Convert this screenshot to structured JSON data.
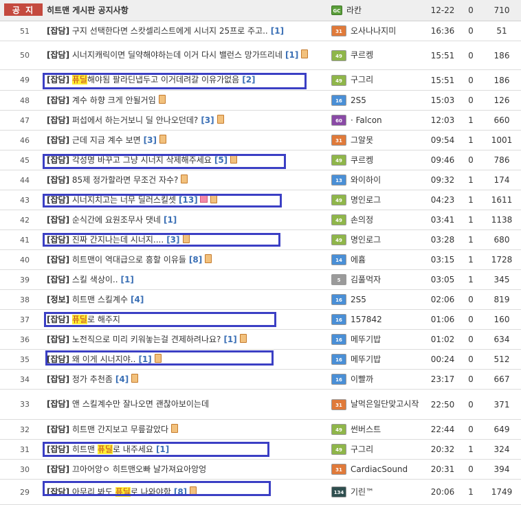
{
  "notice": {
    "badge": "공 지",
    "title": "히트맨 게시판 공지사항",
    "author": "라칸",
    "author_badge": "GC",
    "date": "12-22",
    "recommend": "0",
    "views": "710"
  },
  "rows": [
    {
      "num": "51",
      "cat": "[잡담]",
      "parts": [
        {
          "t": "구지 선택한다면 스캇셀리스트에게 시너지 25프로 주고..",
          "hl": false
        }
      ],
      "comments": "[1]",
      "note": false,
      "img": false,
      "author": "오사나나지미",
      "level": "31",
      "level_color": "#e07a3a",
      "time": "16:36",
      "rec": "0",
      "views": "51"
    },
    {
      "num": "50",
      "cat": "[잡담]",
      "parts": [
        {
          "t": "시너지캐릭이면 딜약해야하는데 이거 다시 밸런스 망가뜨리네",
          "hl": false
        }
      ],
      "comments": "[1]",
      "note": true,
      "img": false,
      "author": "쿠르켕",
      "level": "49",
      "level_color": "#8fb64a",
      "time": "15:51",
      "rec": "0",
      "views": "186"
    },
    {
      "num": "49",
      "cat": "[잡담]",
      "parts": [
        {
          "t": "퓨딜",
          "hl": true
        },
        {
          "t": "해야됨 팔라딘냅두고 이거데려갈 이유가없음",
          "hl": false
        }
      ],
      "comments": "[2]",
      "note": false,
      "img": false,
      "author": "구그리",
      "level": "49",
      "level_color": "#8fb64a",
      "time": "15:51",
      "rec": "0",
      "views": "186"
    },
    {
      "num": "48",
      "cat": "[잡담]",
      "parts": [
        {
          "t": "계수 하향 크게 안될거임",
          "hl": false
        }
      ],
      "comments": "",
      "note": true,
      "img": false,
      "author": "2S5",
      "level": "16",
      "level_color": "#4a8fd6",
      "time": "15:03",
      "rec": "0",
      "views": "126"
    },
    {
      "num": "47",
      "cat": "[잡담]",
      "parts": [
        {
          "t": "퍼섭에서 하는거보니 딜 안나오던데?",
          "hl": false
        }
      ],
      "comments": "[3]",
      "note": true,
      "img": false,
      "author": "· Falcon",
      "level": "60",
      "level_color": "#8a4aa6",
      "time": "12:03",
      "rec": "1",
      "views": "660"
    },
    {
      "num": "46",
      "cat": "[잡담]",
      "parts": [
        {
          "t": "근데 지금 계수 보면",
          "hl": false
        }
      ],
      "comments": "[3]",
      "note": true,
      "img": false,
      "author": "그알못",
      "level": "31",
      "level_color": "#e07a3a",
      "time": "09:54",
      "rec": "1",
      "views": "1001"
    },
    {
      "num": "45",
      "cat": "[잡담]",
      "parts": [
        {
          "t": "각성명 바꾸고 그냥 시너지 삭제해주세요",
          "hl": false
        }
      ],
      "comments": "[5]",
      "note": true,
      "img": false,
      "author": "쿠르켕",
      "level": "49",
      "level_color": "#8fb64a",
      "time": "09:46",
      "rec": "0",
      "views": "786"
    },
    {
      "num": "44",
      "cat": "[잡담]",
      "parts": [
        {
          "t": "85제 정가할라면 무조건 자수?",
          "hl": false
        }
      ],
      "comments": "",
      "note": true,
      "img": false,
      "author": "와이하이",
      "level": "13",
      "level_color": "#4a8fd6",
      "time": "09:32",
      "rec": "1",
      "views": "174"
    },
    {
      "num": "43",
      "cat": "[잡담]",
      "parts": [
        {
          "t": "시너지치고는 너무 딜러스킬셋",
          "hl": false
        }
      ],
      "comments": "[13]",
      "note": true,
      "img": true,
      "author": "명인로그",
      "level": "49",
      "level_color": "#8fb64a",
      "time": "04:23",
      "rec": "1",
      "views": "1611"
    },
    {
      "num": "42",
      "cat": "[잡담]",
      "parts": [
        {
          "t": "순식간에 요원조무사 댓네",
          "hl": false
        }
      ],
      "comments": "[1]",
      "note": false,
      "img": false,
      "author": "손의정",
      "level": "49",
      "level_color": "#8fb64a",
      "time": "03:41",
      "rec": "1",
      "views": "1138"
    },
    {
      "num": "41",
      "cat": "[잡담]",
      "parts": [
        {
          "t": "진짜 간지나는데 시너지....",
          "hl": false
        }
      ],
      "comments": "[3]",
      "note": true,
      "img": false,
      "author": "명인로그",
      "level": "49",
      "level_color": "#8fb64a",
      "time": "03:28",
      "rec": "1",
      "views": "680"
    },
    {
      "num": "40",
      "cat": "[잡담]",
      "parts": [
        {
          "t": "히트맨이 역대급으로 흥할 이유들",
          "hl": false
        }
      ],
      "comments": "[8]",
      "note": true,
      "img": false,
      "author": "에흄",
      "level": "14",
      "level_color": "#4a8fd6",
      "time": "03:15",
      "rec": "1",
      "views": "1728"
    },
    {
      "num": "39",
      "cat": "[잡담]",
      "parts": [
        {
          "t": "스킬 색상이..",
          "hl": false
        }
      ],
      "comments": "[1]",
      "note": false,
      "img": false,
      "author": "김풀먹자",
      "level": "5",
      "level_color": "#9a9a9a",
      "time": "03:05",
      "rec": "1",
      "views": "345"
    },
    {
      "num": "38",
      "cat": "[정보]",
      "parts": [
        {
          "t": "히트맨 스킬계수",
          "hl": false
        }
      ],
      "comments": "[4]",
      "note": false,
      "img": false,
      "author": "2S5",
      "level": "16",
      "level_color": "#4a8fd6",
      "time": "02:06",
      "rec": "0",
      "views": "819"
    },
    {
      "num": "37",
      "cat": "[잡담]",
      "parts": [
        {
          "t": "퓨딜",
          "hl": true
        },
        {
          "t": "로 해주지",
          "hl": false
        }
      ],
      "comments": "",
      "note": false,
      "img": false,
      "author": "157842",
      "level": "16",
      "level_color": "#4a8fd6",
      "time": "01:06",
      "rec": "0",
      "views": "160"
    },
    {
      "num": "36",
      "cat": "[잡담]",
      "parts": [
        {
          "t": "노전직으로 미리 키워놓는걸 견제하려나요?",
          "hl": false
        }
      ],
      "comments": "[1]",
      "note": true,
      "img": false,
      "author": "메뚜기밥",
      "level": "16",
      "level_color": "#4a8fd6",
      "time": "01:02",
      "rec": "0",
      "views": "634"
    },
    {
      "num": "35",
      "cat": "[잡담]",
      "parts": [
        {
          "t": "왜 이게 시너지야..",
          "hl": false
        }
      ],
      "comments": "[1]",
      "note": true,
      "img": false,
      "author": "메뚜기밥",
      "level": "16",
      "level_color": "#4a8fd6",
      "time": "00:24",
      "rec": "0",
      "views": "512"
    },
    {
      "num": "34",
      "cat": "[잡담]",
      "parts": [
        {
          "t": "정가 추천좀",
          "hl": false
        }
      ],
      "comments": "[4]",
      "note": true,
      "img": false,
      "author": "이빨까",
      "level": "16",
      "level_color": "#4a8fd6",
      "time": "23:17",
      "rec": "0",
      "views": "667"
    },
    {
      "num": "33",
      "cat": "[잡담]",
      "parts": [
        {
          "t": "앤 스킬계수만 잘나오면 괜찮아보이는데",
          "hl": false
        }
      ],
      "comments": "",
      "note": false,
      "img": false,
      "author": "날먹은일단맞고시작",
      "level": "31",
      "level_color": "#e07a3a",
      "time": "22:50",
      "rec": "0",
      "views": "371"
    },
    {
      "num": "32",
      "cat": "[잡담]",
      "parts": [
        {
          "t": "히트맨 간지보고 무릎갈았다",
          "hl": false
        }
      ],
      "comments": "",
      "note": true,
      "img": false,
      "author": "썬버스트",
      "level": "49",
      "level_color": "#8fb64a",
      "time": "22:44",
      "rec": "0",
      "views": "649"
    },
    {
      "num": "31",
      "cat": "[잡담]",
      "parts": [
        {
          "t": "히트맨 ",
          "hl": false
        },
        {
          "t": "퓨딜",
          "hl": true
        },
        {
          "t": "로 내주세요",
          "hl": false
        }
      ],
      "comments": "[1]",
      "note": false,
      "img": false,
      "author": "구그리",
      "level": "49",
      "level_color": "#8fb64a",
      "time": "20:32",
      "rec": "1",
      "views": "324"
    },
    {
      "num": "30",
      "cat": "[잡담]",
      "parts": [
        {
          "t": "끄아어앙ㅇ 히트맨오빠 날가져요아앙엉",
          "hl": false
        }
      ],
      "comments": "",
      "note": false,
      "img": false,
      "author": "CardiacSound",
      "level": "31",
      "level_color": "#e07a3a",
      "time": "20:31",
      "rec": "0",
      "views": "394"
    },
    {
      "num": "29",
      "cat": "[잡담]",
      "parts": [
        {
          "t": "아무리 봐도 ",
          "hl": false
        },
        {
          "t": "퓨딜",
          "hl": true
        },
        {
          "t": "로 나와야함",
          "hl": false
        }
      ],
      "comments": "[8]",
      "note": true,
      "img": false,
      "author": "기린™",
      "level": "134",
      "level_color": "#2f4f4f",
      "time": "20:06",
      "rec": "1",
      "views": "1749"
    }
  ]
}
